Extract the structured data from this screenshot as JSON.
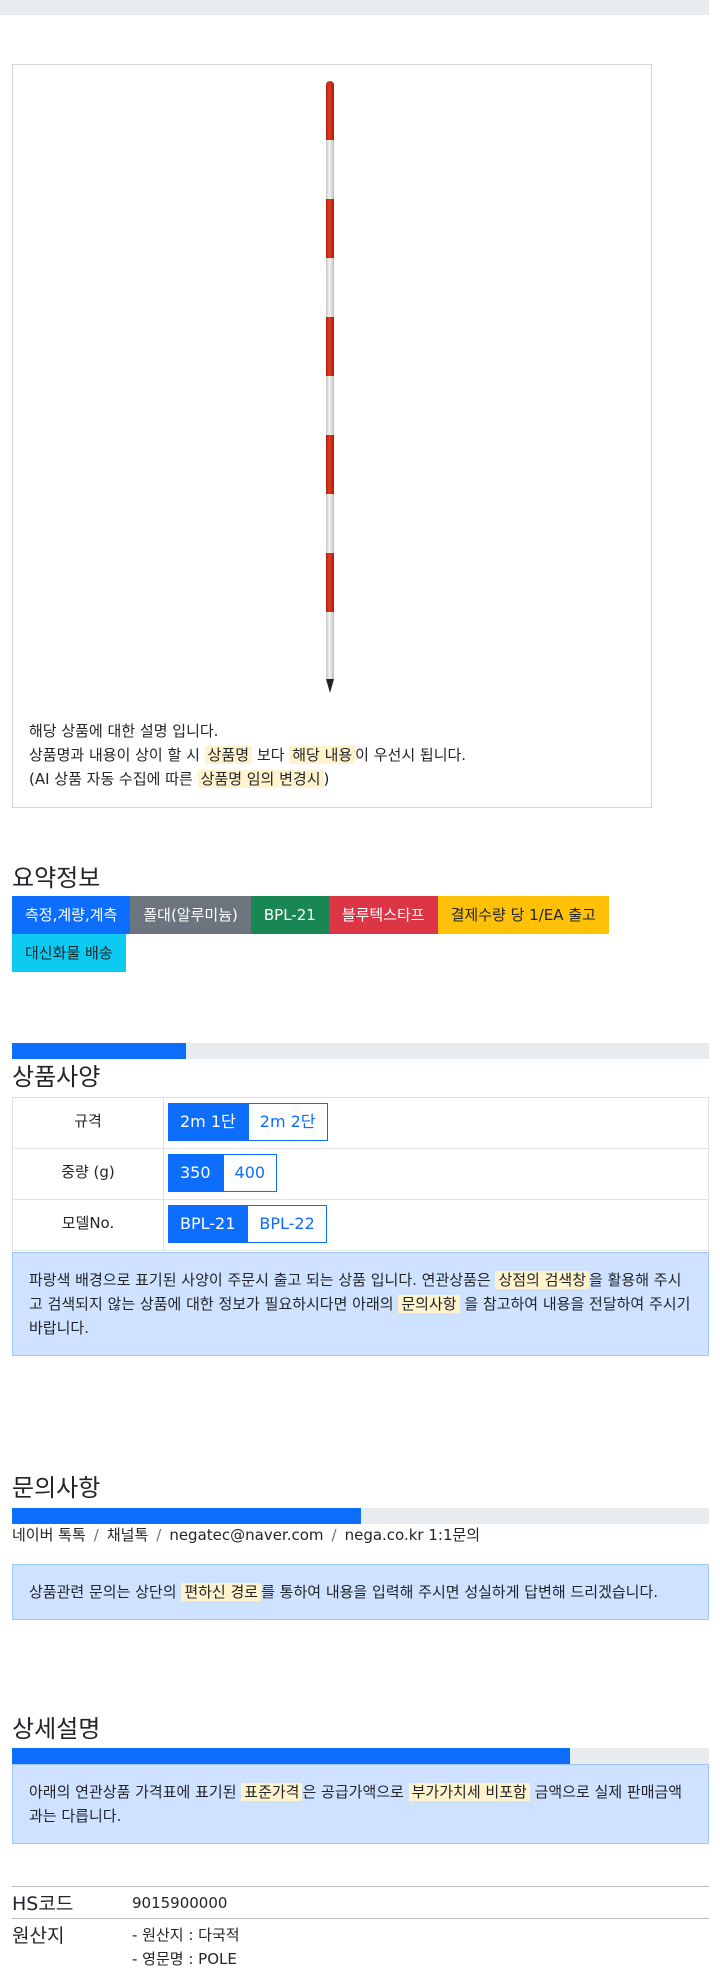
{
  "product": {
    "description": {
      "line1": "해당 상품에 대한 설명 입니다.",
      "line2_pre": "상품명과 내용이 상이 할 시 ",
      "line2_hl1": "상품명",
      "line2_mid": " 보다 ",
      "line2_hl2": "해당 내용",
      "line2_post": "이 우선시 됩니다.",
      "line3_pre": "(AI 상품 자동 수집에 따른 ",
      "line3_hl": "상품명 임의 변경시",
      "line3_post": ")"
    }
  },
  "summary": {
    "title": "요약정보",
    "badges": [
      {
        "label": "측정,계량,계측",
        "color": "#0d6efd"
      },
      {
        "label": "폴대(알루미늄)",
        "color": "#6c757d"
      },
      {
        "label": "BPL-21",
        "color": "#198754"
      },
      {
        "label": "블루텍스타프",
        "color": "#dc3545"
      },
      {
        "label": "결제수량 당 1/EA 출고",
        "color": "#ffc107"
      },
      {
        "label": "대신화물 배송",
        "color": "#0dcaf0"
      }
    ]
  },
  "specs": {
    "title": "상품사양",
    "progress_fraction": 0.25,
    "rows": [
      {
        "label": "규격",
        "options": [
          "2m 1단",
          "2m 2단"
        ],
        "selected": "2m 1단"
      },
      {
        "label": "중량 (g)",
        "options": [
          "350",
          "400"
        ],
        "selected": "350"
      },
      {
        "label": "모델No.",
        "options": [
          "BPL-21",
          "BPL-22"
        ],
        "selected": "BPL-21"
      }
    ],
    "notice": {
      "pre": "파랑색 배경으로 표기된 사양이 주문시 출고 되는 상품 입니다. 연관상품은 ",
      "hl1": "상점의 검색창",
      "mid": "을 활용해 주시고 검색되지 않는 상품에 대한 정보가 필요하시다면 아래의 ",
      "hl2": "문의사항",
      "post": " 을 참고하여 내용을 전달하여 주시기 바랍니다."
    }
  },
  "inquiry": {
    "title": "문의사항",
    "progress_fraction": 0.5,
    "links": [
      "네이버 톡톡",
      "채널톡",
      "negatec@naver.com",
      "nega.co.kr 1:1문의"
    ],
    "separator": "/",
    "notice": {
      "pre": "상품관련 문의는 상단의 ",
      "hl": "편하신 경로",
      "post": "를 통하여 내용을 입력해 주시면 성실하게 답변해 드리겠습니다."
    }
  },
  "detail": {
    "title": "상세설명",
    "progress_fraction": 0.8,
    "notice": {
      "pre": "아래의 연관상품 가격표에 표기된 ",
      "hl1": "표준가격",
      "mid": "은 공급가액으로 ",
      "hl2": "부가가치세 비포함",
      "post": " 금액으로 실제 판매금액과는 다릅니다."
    },
    "hs_label": "HS코드",
    "hs_value": "9015900000",
    "origin_label": "원산지",
    "origin_line1": "- 원산지 : 다국적",
    "origin_line2": "- 영문명 : POLE"
  }
}
